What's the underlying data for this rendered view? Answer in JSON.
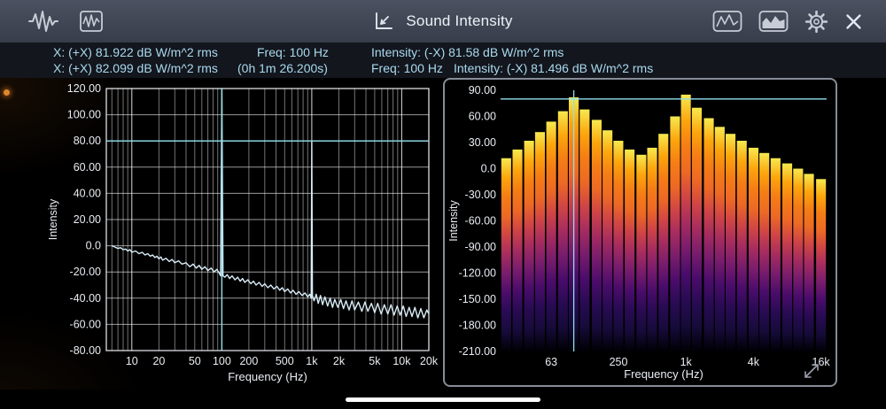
{
  "app": {
    "title": "Sound Intensity"
  },
  "readouts": {
    "row1": [
      "X: (+X) 81.922 dB W/m^2 rms",
      "Freq: 100 Hz",
      "Intensity: (-X) 81.58 dB W/m^2 rms"
    ],
    "row2": [
      "X: (+X) 82.099 dB W/m^2 rms",
      "(0h  1m 26.200s)",
      "Freq: 100 Hz",
      "Intensity: (-X) 81.496 dB W/m^2 rms"
    ]
  },
  "colors": {
    "cursor_cyan": "#8fdfeb",
    "trace": "#d9edf8",
    "tick_text": "#e9edf3",
    "readout_text": "#a9d9ee",
    "bar_gradient": [
      "#f6e94f",
      "#fca60c",
      "#f57d15",
      "#ed6925",
      "#cf4446",
      "#a52c60",
      "#781c6d",
      "#4a0c6b",
      "#280b53",
      "#160b39",
      "#000004"
    ]
  },
  "chart_data": [
    {
      "type": "line",
      "title": "",
      "xlabel": "Frequency (Hz)",
      "ylabel": "Intensity",
      "xscale": "log",
      "xlim": [
        5.2,
        20000
      ],
      "ylim": [
        -80,
        120
      ],
      "yticks": [
        120,
        100,
        80,
        60,
        40,
        20,
        0,
        -20,
        -40,
        -60,
        -80
      ],
      "ytick_labels": [
        "120.00",
        "100.00",
        "80.00",
        "60.00",
        "40.00",
        "20.00",
        "0.0",
        "-20.00",
        "-40.00",
        "-60.00",
        "-80.00"
      ],
      "xticks": [
        10,
        20,
        50,
        100,
        200,
        500,
        1000,
        2000,
        5000,
        10000,
        20000
      ],
      "xtick_labels": [
        "10",
        "20",
        "50",
        "100",
        "200",
        "500",
        "1k",
        "2k",
        "5k",
        "10k",
        "20k"
      ],
      "cursor": {
        "freq": 100,
        "level": 80
      },
      "points": [
        [
          6,
          0
        ],
        [
          6.5,
          -1
        ],
        [
          7,
          -2
        ],
        [
          7.5,
          -1.5
        ],
        [
          8,
          -3
        ],
        [
          8.5,
          -2.5
        ],
        [
          9,
          -4
        ],
        [
          9.5,
          -3
        ],
        [
          10,
          -5
        ],
        [
          11,
          -4
        ],
        [
          12,
          -6
        ],
        [
          13,
          -5
        ],
        [
          14,
          -7
        ],
        [
          15,
          -6
        ],
        [
          16,
          -8
        ],
        [
          17,
          -7
        ],
        [
          18,
          -9
        ],
        [
          19,
          -8
        ],
        [
          20,
          -10
        ],
        [
          21,
          -8.5
        ],
        [
          22,
          -11
        ],
        [
          24,
          -9.5
        ],
        [
          26,
          -12
        ],
        [
          28,
          -10.5
        ],
        [
          30,
          -13
        ],
        [
          33,
          -11.5
        ],
        [
          36,
          -14
        ],
        [
          40,
          -13
        ],
        [
          44,
          -16
        ],
        [
          48,
          -14
        ],
        [
          52,
          -17
        ],
        [
          56,
          -15
        ],
        [
          60,
          -18
        ],
        [
          65,
          -16
        ],
        [
          70,
          -19
        ],
        [
          76,
          -17
        ],
        [
          82,
          -20
        ],
        [
          88,
          -18
        ],
        [
          94,
          -21
        ],
        [
          97,
          -23
        ],
        [
          100,
          122
        ],
        [
          103,
          -23
        ],
        [
          108,
          -24
        ],
        [
          115,
          -22
        ],
        [
          122,
          -25
        ],
        [
          130,
          -23
        ],
        [
          140,
          -26
        ],
        [
          150,
          -24
        ],
        [
          160,
          -27
        ],
        [
          170,
          -25
        ],
        [
          180,
          -28
        ],
        [
          195,
          -26
        ],
        [
          210,
          -29
        ],
        [
          225,
          -27
        ],
        [
          240,
          -30
        ],
        [
          260,
          -28
        ],
        [
          280,
          -31
        ],
        [
          300,
          -29
        ],
        [
          325,
          -32
        ],
        [
          350,
          -30
        ],
        [
          380,
          -33
        ],
        [
          410,
          -31
        ],
        [
          440,
          -34
        ],
        [
          470,
          -32
        ],
        [
          500,
          -35
        ],
        [
          540,
          -33
        ],
        [
          580,
          -36
        ],
        [
          620,
          -34
        ],
        [
          670,
          -37
        ],
        [
          720,
          -35
        ],
        [
          780,
          -38
        ],
        [
          840,
          -36
        ],
        [
          900,
          -39
        ],
        [
          950,
          -37
        ],
        [
          985,
          -40
        ],
        [
          1000,
          80
        ],
        [
          1015,
          -38
        ],
        [
          1060,
          -42
        ],
        [
          1120,
          -37
        ],
        [
          1180,
          -44
        ],
        [
          1250,
          -38
        ],
        [
          1320,
          -45
        ],
        [
          1400,
          -39
        ],
        [
          1500,
          -46
        ],
        [
          1600,
          -40
        ],
        [
          1700,
          -47
        ],
        [
          1800,
          -41
        ],
        [
          1950,
          -47
        ],
        [
          2100,
          -41
        ],
        [
          2250,
          -48
        ],
        [
          2400,
          -42
        ],
        [
          2600,
          -49
        ],
        [
          2800,
          -42
        ],
        [
          3000,
          -49
        ],
        [
          3300,
          -43
        ],
        [
          3600,
          -50
        ],
        [
          3900,
          -43
        ],
        [
          4200,
          -50
        ],
        [
          4600,
          -44
        ],
        [
          5000,
          -51
        ],
        [
          5400,
          -44
        ],
        [
          5900,
          -52
        ],
        [
          6400,
          -45
        ],
        [
          7000,
          -52
        ],
        [
          7600,
          -45
        ],
        [
          8200,
          -53
        ],
        [
          8900,
          -46
        ],
        [
          9600,
          -53
        ],
        [
          10400,
          -46
        ],
        [
          11200,
          -54
        ],
        [
          12100,
          -47
        ],
        [
          13000,
          -54
        ],
        [
          14000,
          -47
        ],
        [
          15100,
          -55
        ],
        [
          16300,
          -48
        ],
        [
          17600,
          -55
        ],
        [
          19000,
          -49
        ],
        [
          20000,
          -52
        ]
      ]
    },
    {
      "type": "bar",
      "title": "",
      "xlabel": "Frequency (Hz)",
      "ylabel": "Intensity",
      "xscale": "log",
      "ylim": [
        -210,
        90
      ],
      "yticks": [
        90,
        60,
        30,
        0,
        -30,
        -60,
        -90,
        -120,
        -150,
        -180,
        -210
      ],
      "ytick_labels": [
        "90.00",
        "60.00",
        "30.00",
        "0.0",
        "-30.00",
        "-60.00",
        "-90.00",
        "-120.00",
        "-150.00",
        "-180.00",
        "-210.00"
      ],
      "xticks": [
        63,
        250,
        1000,
        4000,
        16000
      ],
      "xtick_labels": [
        "63",
        "250",
        "1k",
        "4k",
        "16k"
      ],
      "cursor": {
        "freq": 100,
        "level": 80
      },
      "bands": [
        25,
        31.5,
        40,
        50,
        63,
        80,
        100,
        125,
        160,
        200,
        250,
        315,
        400,
        500,
        630,
        800,
        1000,
        1250,
        1600,
        2000,
        2500,
        3150,
        4000,
        5000,
        6300,
        8000,
        10000,
        12500,
        16000
      ],
      "values": [
        12,
        22,
        32,
        42,
        54,
        66,
        82,
        68,
        56,
        44,
        32,
        22,
        16,
        24,
        40,
        60,
        85,
        70,
        58,
        48,
        40,
        32,
        24,
        18,
        12,
        6,
        0,
        -6,
        -12
      ]
    }
  ]
}
